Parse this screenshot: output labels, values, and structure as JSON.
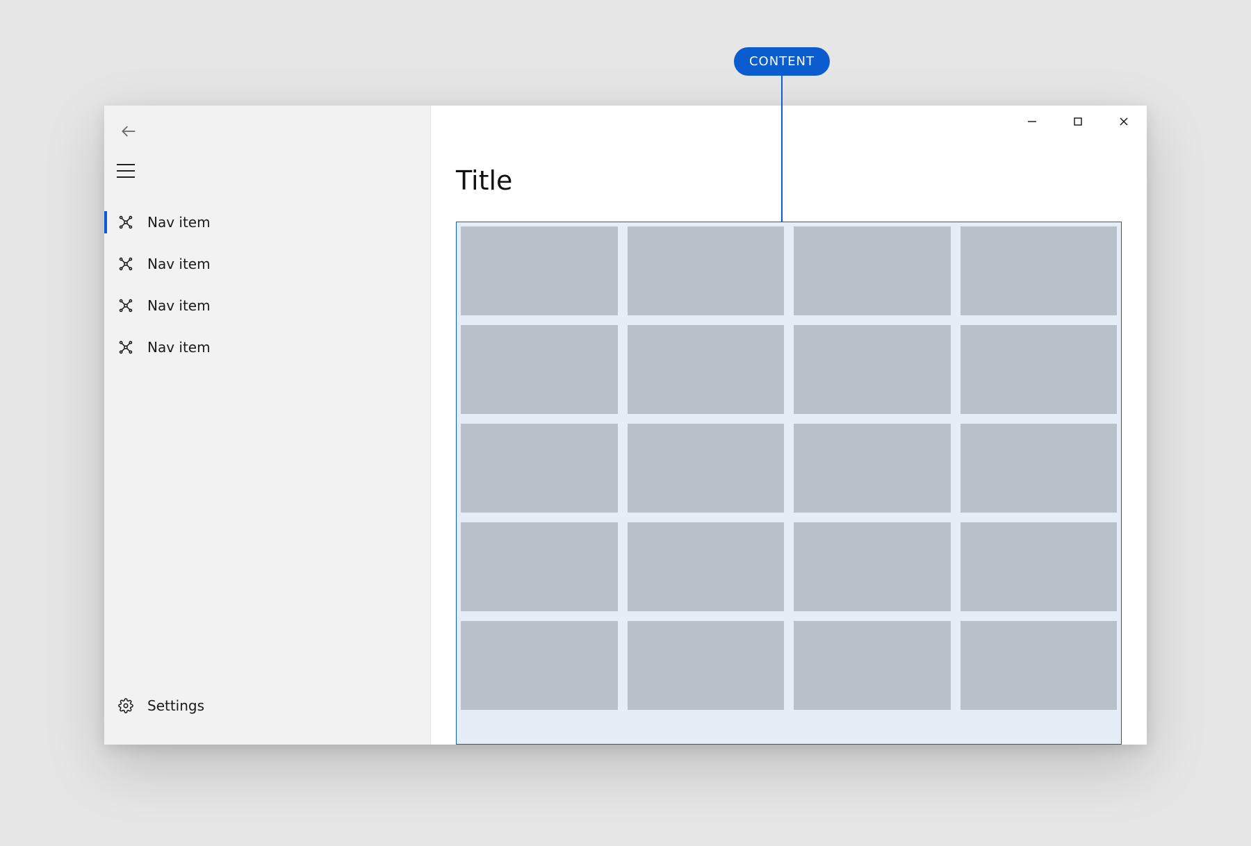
{
  "annotation": {
    "label": "CONTENT"
  },
  "colors": {
    "accent": "#0b5cce",
    "tile": "#b9c0ca",
    "content_bg": "#e7edf7",
    "nav_bg": "#f2f2f2"
  },
  "nav": {
    "items": [
      {
        "label": "Nav item",
        "selected": true
      },
      {
        "label": "Nav item",
        "selected": false
      },
      {
        "label": "Nav item",
        "selected": false
      },
      {
        "label": "Nav item",
        "selected": false
      }
    ],
    "settings_label": "Settings"
  },
  "main": {
    "title": "Title",
    "grid": {
      "columns": 4,
      "rows_visible": 5
    }
  }
}
